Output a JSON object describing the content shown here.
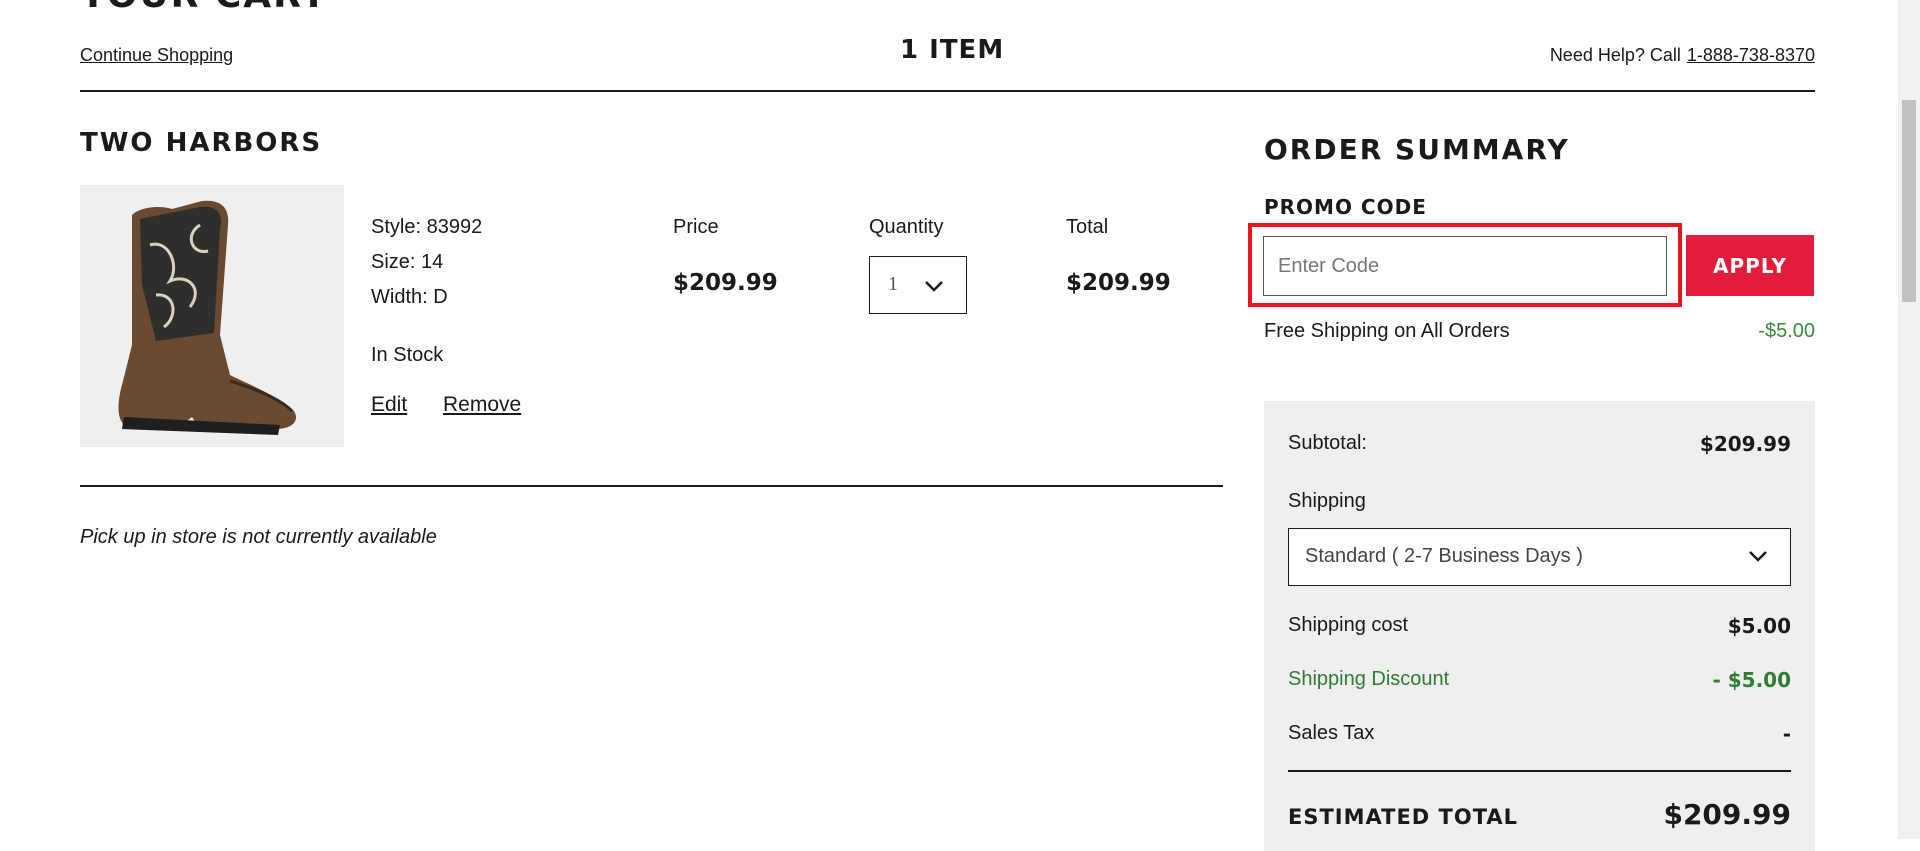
{
  "header": {
    "page_title": "YOUR CART",
    "continue_label": "Continue Shopping",
    "item_count": "1 ITEM",
    "help_text": "Need Help? Call",
    "help_phone": "1-888-738-8370"
  },
  "cart_item": {
    "name": "TWO HARBORS",
    "style": "Style: 83992",
    "size": "Size: 14",
    "width": "Width: D",
    "stock": "In Stock",
    "edit_label": "Edit",
    "remove_label": "Remove",
    "price_label": "Price",
    "price": "$209.99",
    "quantity_label": "Quantity",
    "quantity": "1",
    "total_label": "Total",
    "total": "$209.99",
    "image_icon": "boot-product-image"
  },
  "pickup_note": "Pick up in store is not currently available",
  "summary": {
    "title": "ORDER SUMMARY",
    "promo_label": "PROMO CODE",
    "promo_placeholder": "Enter Code",
    "apply_label": "APPLY",
    "free_shipping_label": "Free Shipping on All Orders",
    "free_shipping_value": "-$5.00",
    "subtotal_label": "Subtotal:",
    "subtotal_value": "$209.99",
    "shipping_label": "Shipping",
    "shipping_option": "Standard ( 2-7 Business Days )",
    "shipping_cost_label": "Shipping cost",
    "shipping_cost_value": "$5.00",
    "shipping_discount_label": "Shipping Discount",
    "shipping_discount_value": "- $5.00",
    "sales_tax_label": "Sales Tax",
    "sales_tax_value": "-",
    "estimated_total_label": "ESTIMATED TOTAL",
    "estimated_total_value": "$209.99"
  },
  "colors": {
    "accent_red": "#e21c3a",
    "highlight_red": "#e8161c",
    "discount_green": "#2e7d32",
    "summary_bg": "#efefef"
  }
}
